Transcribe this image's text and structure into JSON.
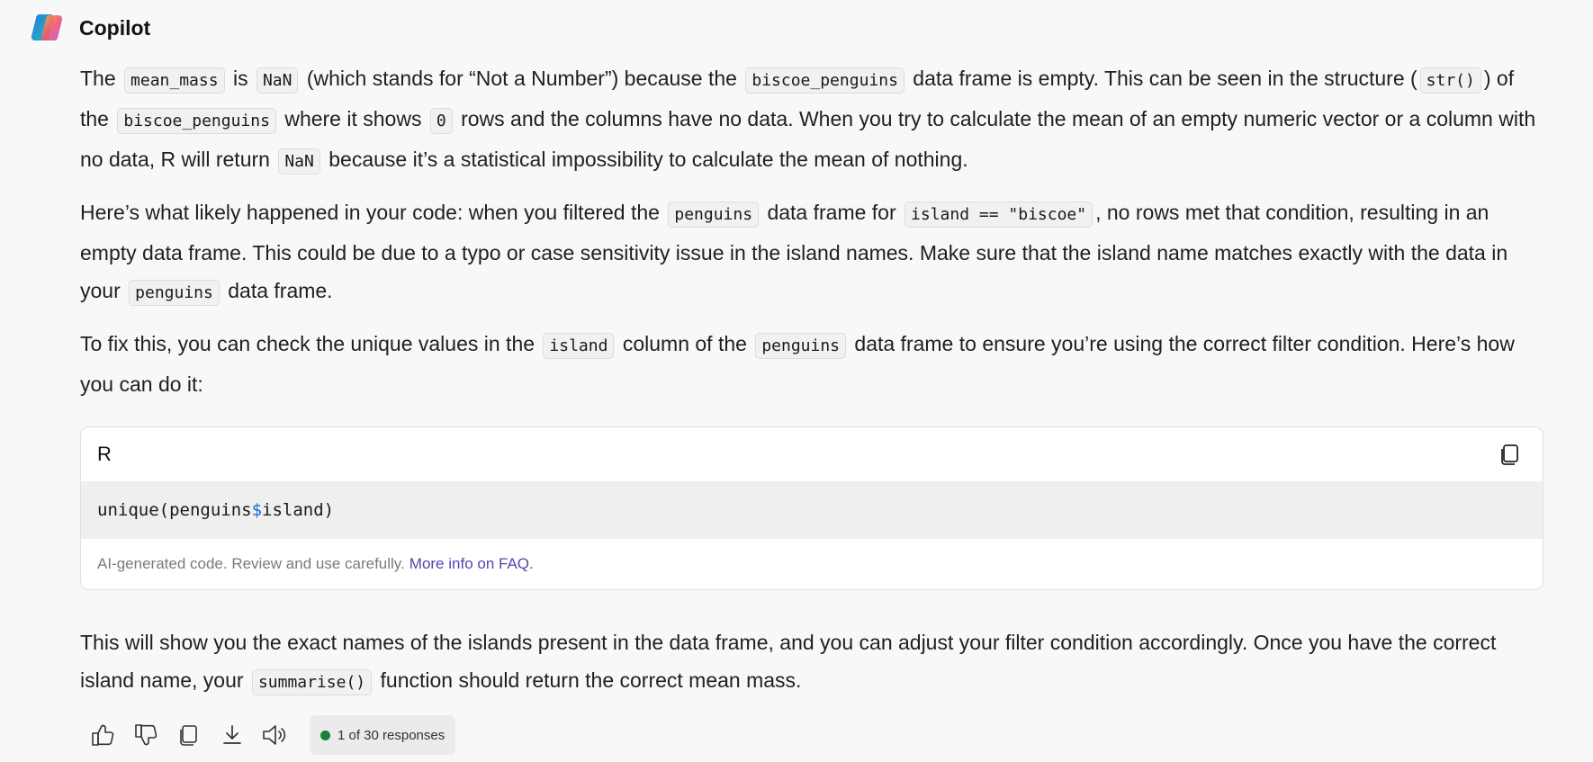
{
  "app": {
    "title": "Copilot"
  },
  "message": {
    "p1": {
      "t1": "The ",
      "c1": "mean_mass",
      "t2": " is ",
      "c2": "NaN",
      "t3": " (which stands for “Not a Number”) because the ",
      "c3": "biscoe_penguins",
      "t4": " data frame is empty. This can be seen in the structure (",
      "c4": "str()",
      "t5": ") of the ",
      "c5": "biscoe_penguins",
      "t6": " where it shows ",
      "c6": "0",
      "t7": " rows and the columns have no data. When you try to calculate the mean of an empty numeric vector or a column with no data, R will return ",
      "c7": "NaN",
      "t8": " because it’s a statistical impossibility to calculate the mean of nothing."
    },
    "p2": {
      "t1": "Here’s what likely happened in your code: when you filtered the ",
      "c1": "penguins",
      "t2": " data frame for ",
      "c2": "island == \"biscoe\"",
      "t3": ", no rows met that condition, resulting in an empty data frame. This could be due to a typo or case sensitivity issue in the island names. Make sure that the island name matches exactly with the data in your ",
      "c3": "penguins",
      "t4": " data frame."
    },
    "p3": {
      "t1": "To fix this, you can check the unique values in the ",
      "c1": "island",
      "t2": " column of the ",
      "c2": "penguins",
      "t3": " data frame to ensure you’re using the correct filter condition. Here’s how you can do it:"
    },
    "code_block": {
      "language": "R",
      "code_before": "unique(penguins",
      "code_op": "$",
      "code_after": "island)",
      "footer_text": "AI-generated code. Review and use carefully.",
      "footer_link": "More info on FAQ."
    },
    "p4": {
      "t1": "This will show you the exact names of the islands present in the data frame, and you can adjust your filter condition accordingly. Once you have the correct island name, your ",
      "c1": "summarise()",
      "t2": " function should return the correct mean mass."
    }
  },
  "actions": {
    "response_counter": "1 of 30 responses",
    "icons": [
      "thumbs-up-icon",
      "thumbs-down-icon",
      "copy-icon",
      "download-icon",
      "speaker-icon"
    ]
  },
  "colors": {
    "background": "#f8f8f8",
    "link": "#5a3fb0",
    "status_dot": "#1a7f37",
    "code_operator": "#1a6fd1"
  }
}
